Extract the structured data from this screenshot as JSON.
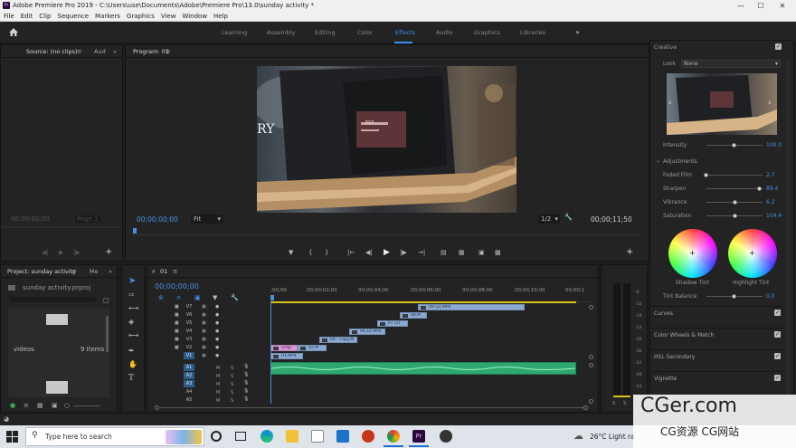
{
  "window": {
    "title": "Adobe Premiere Pro 2019 - C:\\Users\\use\\Documents\\Adobe\\Premiere Pro\\13.0\\sunday activity *",
    "app_icon_label": "Pr"
  },
  "menu": [
    "File",
    "Edit",
    "Clip",
    "Sequence",
    "Markers",
    "Graphics",
    "View",
    "Window",
    "Help"
  ],
  "workspaces": {
    "tabs": [
      "Learning",
      "Assembly",
      "Editing",
      "Color",
      "Effects",
      "Audio",
      "Graphics",
      "Libraries"
    ],
    "active": "Effects",
    "more": "»"
  },
  "source_panel": {
    "tab_source": "Source: (no clips)",
    "tab_audio": "Aud",
    "timecode": "00;00;00;00",
    "page": "Page 1"
  },
  "program_panel": {
    "tab": "Program: 01",
    "timecode": "00;00;00;00",
    "fit": "Fit",
    "resolution": "1/2",
    "duration": "00;00;11;50",
    "overlay_text": "RY",
    "label_text": "ESP"
  },
  "project_panel": {
    "tab": "Project: sunday activity",
    "tab2": "Me",
    "file": "sunday activity.prproj",
    "bin_name": "videos",
    "bin_count": "9 Items"
  },
  "timeline": {
    "tab": "01",
    "timecode": "00;00;00;00",
    "ruler": [
      ";00;00",
      "00;00;02;00",
      "00;00;04;00",
      "00;00;06;00",
      "00;00;08;00",
      "00;00;10;00",
      "00;00;1"
    ],
    "video_tracks": [
      "V7",
      "V6",
      "V5",
      "V4",
      "V3",
      "V2",
      "V1"
    ],
    "audio_tracks": [
      "A1",
      "A2",
      "A3",
      "A4",
      "A5"
    ],
    "clips": [
      {
        "label": "09 (2).MP4",
        "color": "blue"
      },
      {
        "label": "08.M",
        "color": "blue"
      },
      {
        "label": "07 (2)",
        "color": "blue"
      },
      {
        "label": "06.10.MP4",
        "color": "blue"
      },
      {
        "label": "04 - Copy.M",
        "color": "blue"
      },
      {
        "label": "Grap",
        "color": "pink"
      },
      {
        "label": "02.M",
        "color": "blue"
      },
      {
        "label": "01.MP4",
        "color": "blue"
      }
    ],
    "track_toggle_m": "M",
    "track_toggle_s": "S"
  },
  "audio_meter": {
    "scale": [
      "-6",
      "-12",
      "-18",
      "-24",
      "-30",
      "-36",
      "-42",
      "-48",
      "-54"
    ],
    "solo_labels": [
      "S",
      "S"
    ]
  },
  "lumetri": {
    "creative": "Creative",
    "look_label": "Look",
    "look_value": "None",
    "intensity_label": "Intensity",
    "intensity_value": "100.0",
    "adjustments": "Adjustments",
    "faded_film_label": "Faded Film",
    "faded_film_value": "2.7",
    "sharpen_label": "Sharpen",
    "sharpen_value": "89.4",
    "vibrance_label": "Vibrance",
    "vibrance_value": "6.2",
    "saturation_label": "Saturation",
    "saturation_value": "104.4",
    "shadow_tint": "Shadow Tint",
    "highlight_tint": "Highlight Tint",
    "tint_balance_label": "Tint Balance",
    "tint_balance_value": "0.0",
    "sections": [
      "Curves",
      "Color Wheels & Match",
      "HSL Secondary",
      "Vignette"
    ]
  },
  "taskbar": {
    "search_placeholder": "Type here to search",
    "weather": "26°C  Light ra"
  },
  "watermark": {
    "main": "CGer.com",
    "sub": "CG资源 CG网站"
  },
  "colors": {
    "accent_blue": "#3d8ee8",
    "clip_blue": "#8da9cf",
    "clip_pink": "#d39ad3",
    "audio_green": "#2ea870",
    "playhead": "#4b8fe0"
  }
}
